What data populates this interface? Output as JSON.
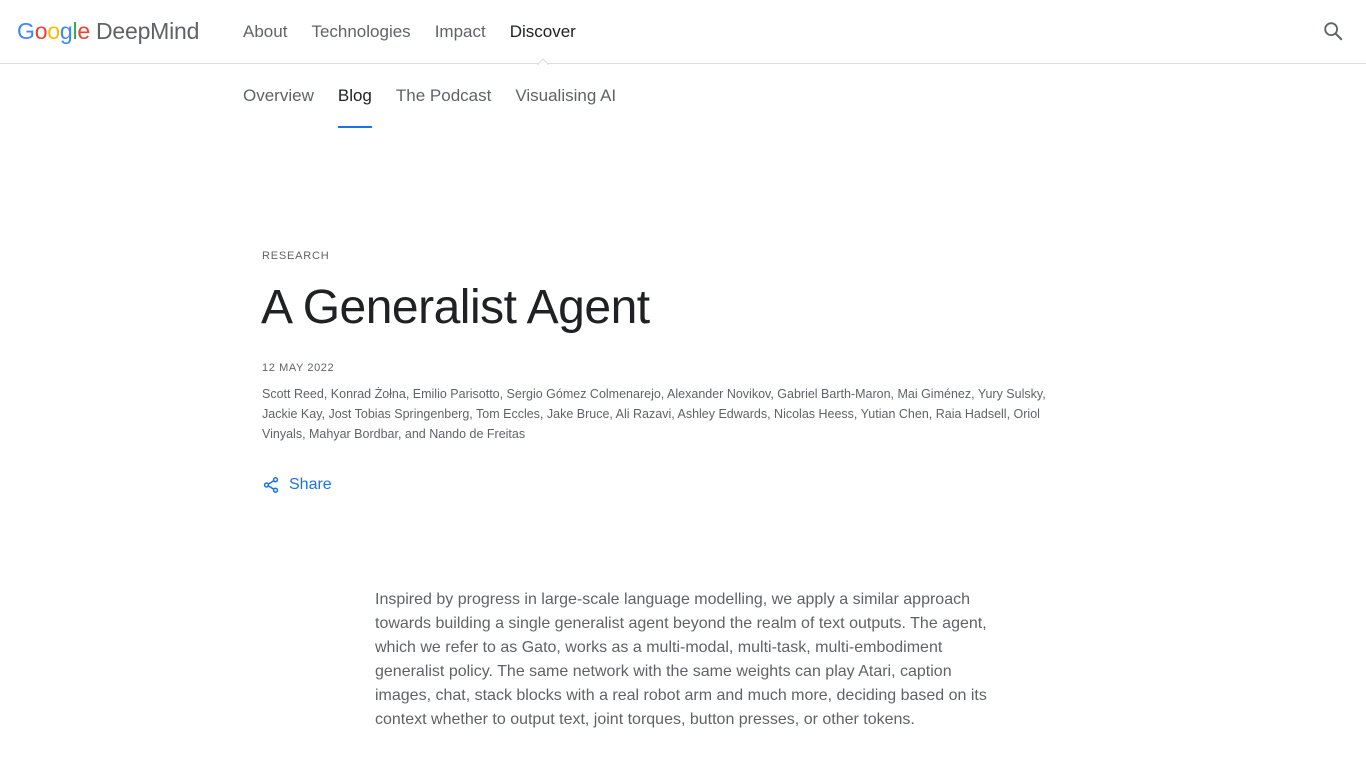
{
  "header": {
    "logo": {
      "google": [
        "G",
        "o",
        "o",
        "g",
        "l",
        "e"
      ],
      "product": "DeepMind"
    },
    "nav": [
      {
        "label": "About"
      },
      {
        "label": "Technologies"
      },
      {
        "label": "Impact"
      },
      {
        "label": "Discover",
        "active": true
      }
    ]
  },
  "subnav": [
    {
      "label": "Overview"
    },
    {
      "label": "Blog",
      "active": true
    },
    {
      "label": "The Podcast"
    },
    {
      "label": "Visualising AI"
    }
  ],
  "article": {
    "category": "RESEARCH",
    "title": "A Generalist Agent",
    "date": "12 MAY 2022",
    "authors": "Scott Reed, Konrad Żołna, Emilio Parisotto, Sergio Gómez Colmenarejo, Alexander Novikov, Gabriel Barth-Maron, Mai Giménez, Yury Sulsky, Jackie Kay, Jost Tobias Springenberg, Tom Eccles, Jake Bruce, Ali Razavi, Ashley Edwards, Nicolas Heess, Yutian Chen, Raia Hadsell, Oriol Vinyals, Mahyar Bordbar, and Nando de Freitas",
    "share_label": "Share",
    "lede": "Inspired by progress in large-scale language modelling, we apply a similar approach towards building a single generalist agent beyond the realm of text outputs. The agent, which we refer to as Gato, works as a multi-modal, multi-task, multi-embodiment generalist policy. The same network with the same weights can play Atari, caption images, chat, stack blocks with a real robot arm and much more, deciding based on its context whether to output text, joint torques, button presses, or other tokens."
  },
  "icons": {
    "search": "search-icon",
    "share": "share-icon"
  },
  "colors": {
    "accent": "#1a73e8",
    "google_blue": "#4285f4",
    "google_red": "#ea4335",
    "google_yellow": "#fbbc05",
    "google_green": "#34a853"
  }
}
